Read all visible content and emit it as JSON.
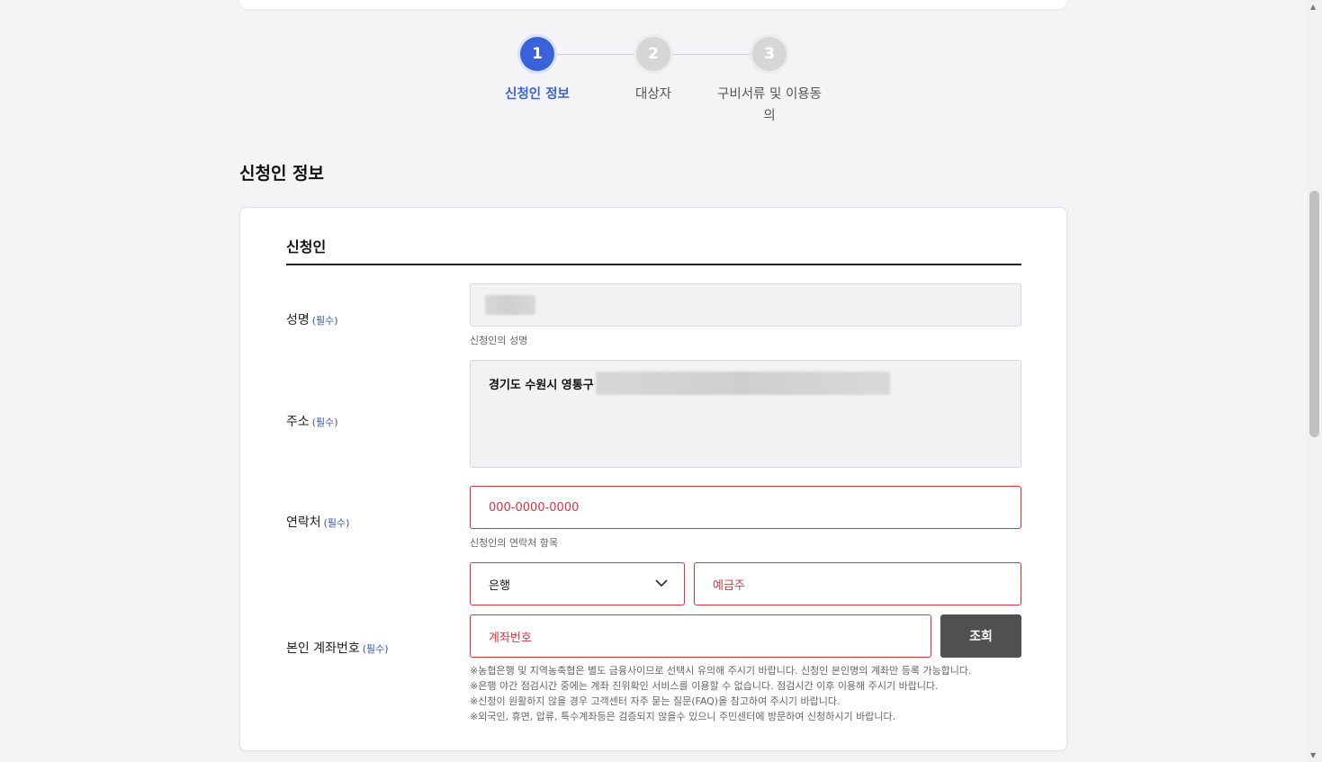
{
  "stepper": {
    "steps": [
      {
        "number": "1",
        "label": "신청인 정보"
      },
      {
        "number": "2",
        "label": "대상자"
      },
      {
        "number": "3",
        "label": "구비서류 및 이용동의"
      }
    ]
  },
  "section_title": "신청인 정보",
  "card": {
    "title": "신청인",
    "required_tag": "(필수)",
    "name": {
      "label": "성명",
      "helper": "신청인의 성명"
    },
    "address": {
      "label": "주소",
      "value": "경기도 수원시 영통구"
    },
    "phone": {
      "label": "연락처",
      "placeholder": "000-0000-0000",
      "helper": "신청인의 연락처 항목"
    },
    "account": {
      "label": "본인 계좌번호",
      "bank_select": "은행",
      "holder_placeholder": "예금주",
      "number_placeholder": "계좌번호",
      "search_button": "조회",
      "notes": [
        "※농협은행 및 지역농축협은 별도 금융사이므로 선택시 유의해 주시기 바랍니다. 신청인 본인명의 계좌만 등록 가능합니다.",
        "※은행 야간 점검시간 중에는 계좌 진위확인 서비스를 이용할 수 없습니다. 점검시간 이후 이용해 주시기 바랍니다.",
        "※신청이 원활하지 않을 경우 고객센터 자주 묻는 질문(FAQ)을 참고하여 주시기 바랍니다.",
        "※외국인, 휴면, 압류, 특수계좌등은 검증되지 않을수 있으니 주민센터에 방문하여 신청하시기 바랍니다."
      ]
    }
  },
  "colors": {
    "accent": "#3c62d9",
    "error": "#d9333f",
    "button": "#505050"
  }
}
